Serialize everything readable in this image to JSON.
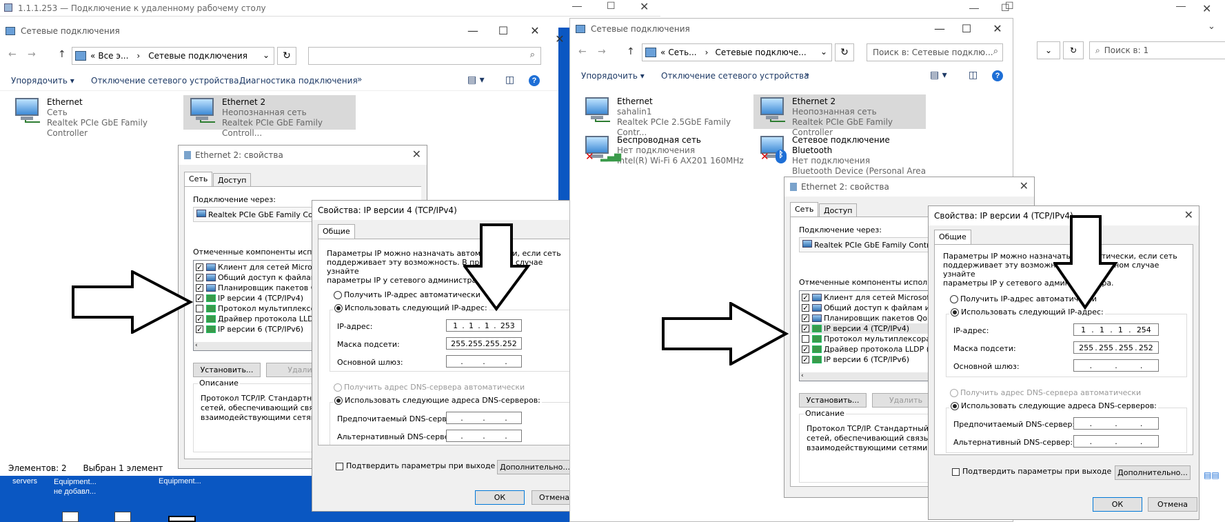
{
  "rdp": {
    "title": "1.1.1.253 — Подключение к удаленному рабочему столу"
  },
  "left": {
    "window_title": "Сетевые подключения",
    "address_parts": [
      "«",
      "Все э...",
      "›",
      "Сетевые подключения"
    ],
    "toolbar": [
      "Упорядочить ▾",
      "Отключение сетевого устройства",
      "Диагностика подключения",
      "»"
    ],
    "items": [
      {
        "name": "Ethernet",
        "status": "Сеть",
        "device": "Realtek PCIe GbE Family Controller"
      },
      {
        "name": "Ethernet 2",
        "status": "Неопознанная сеть",
        "device": "Realtek PCIe GbE Family Controll..."
      }
    ],
    "statusbar": {
      "count": "Элементов: 2",
      "selected": "Выбран 1 элемент"
    },
    "desktop": [
      "servers",
      "Equipment...\nне добавл...",
      "Equipment..."
    ]
  },
  "right": {
    "window_title": "Сетевые подключения",
    "address_parts": [
      "«",
      "Сеть...",
      "›",
      "Сетевые подключе..."
    ],
    "search_placeholder": "Поиск в: Сетевые подклю...",
    "search_bg": "Поиск в: 1",
    "toolbar": [
      "Упорядочить ▾",
      "Отключение сетевого устройства",
      "»"
    ],
    "items": [
      {
        "name": "Ethernet",
        "status": "sahalin1",
        "device": "Realtek PCIe 2.5GbE Family Contr..."
      },
      {
        "name": "Ethernet 2",
        "status": "Неопознанная сеть",
        "device": "Realtek PCIe GbE Family Controller"
      },
      {
        "name": "Беспроводная сеть",
        "status": "Нет подключения",
        "device": "Intel(R) Wi-Fi 6 AX201 160MHz"
      },
      {
        "name": "Сетевое подключение Bluetooth",
        "status": "Нет подключения",
        "device": "Bluetooth Device (Personal Area ..."
      }
    ]
  },
  "props": {
    "title": "Ethernet 2: свойства",
    "tab_net": "Сеть",
    "tab_access": "Доступ",
    "connect_via": "Подключение через:",
    "adapter": "Realtek PCIe GbE Family Contr",
    "adapter_r": "Realtek PCIe GbE Family Controll",
    "components_label": "Отмеченные компоненты использ",
    "components_label_r": "Отмеченные компоненты использу",
    "components": [
      "Клиент для сетей Microso",
      "Общий доступ к файлам и",
      "Планировщик пакетов Qo",
      "IP версии 4 (TCP/IPv4)",
      "Протокол мультиплексора",
      "Драйвер протокола LLDP",
      "IP версии 6 (TCP/IPv6)"
    ],
    "components_r": [
      "Клиент для сетей Microsoft",
      "Общий доступ к файлам и пр",
      "Планировщик пакетов QoS",
      "IP версии 4 (TCP/IPv4)",
      "Протокол мультиплексора с",
      "Драйвер протокола LLDP (М",
      "IP версии 6 (TCP/IPv6)"
    ],
    "install": "Установить...",
    "remove": "Удали",
    "remove_r": "Удалить",
    "desc_label": "Описание",
    "desc": "Протокол TCP/IP. Стандартный\nсетей, обеспечивающий связь\nвзаимодействующими сетями.",
    "desc_r": "Протокол TCP/IP. Стандартный пр\nсетей, обеспечивающий связь ме\nвзаимодействующими сетями."
  },
  "ipv4": {
    "title": "Свойства: IP версии 4 (TCP/IPv4)",
    "tab": "Общие",
    "intro": "Параметры IP можно назначать автоматически, если сеть\nподдерживает эту возможность. В противном случае узнайте\nпараметры IP у сетевого администратора.",
    "auto_ip": "Получить IP-адрес автоматически",
    "manual_ip": "Использовать следующий IP-адрес:",
    "ip_label": "IP-адрес:",
    "mask_label": "Маска подсети:",
    "gw_label": "Основной шлюз:",
    "auto_dns": "Получить адрес DNS-сервера автоматически",
    "manual_dns": "Использовать следующие адреса DNS-серверов:",
    "pref_dns": "Предпочитаемый DNS-сервер:",
    "alt_dns": "Альтернативный DNS-сервер:",
    "validate": "Подтвердить параметры при выходе",
    "advanced": "Дополнительно...",
    "ok": "ОК",
    "cancel": "Отмена",
    "left_ip": [
      "1",
      "1",
      "1",
      "253"
    ],
    "right_ip": [
      "1",
      "1",
      "1",
      "254"
    ],
    "mask": [
      "255",
      "255",
      "255",
      "252"
    ]
  },
  "colors": {
    "toolbar_text": "#1e3a66",
    "selection": "#d9d9d9",
    "desktop_blue": "#0a57c2",
    "help_blue": "#1e6fd6"
  }
}
